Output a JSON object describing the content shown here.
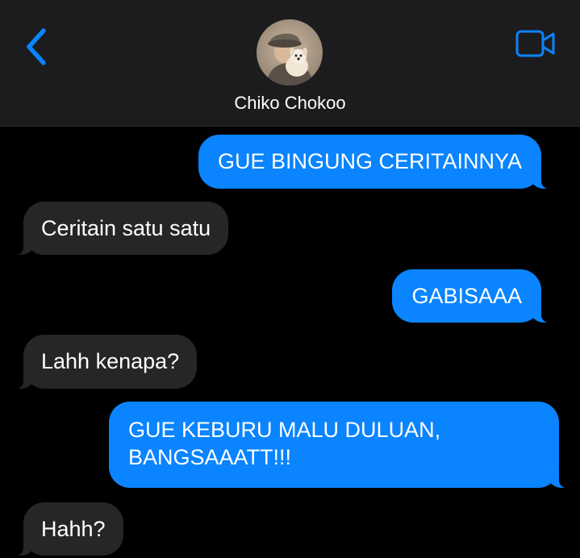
{
  "header": {
    "contact_name": "Chiko Chokoo",
    "back_icon": "chevron-left-icon",
    "video_icon": "video-camera-icon",
    "accent_color": "#0a84ff"
  },
  "messages": [
    {
      "direction": "sent",
      "text": "GUE BINGUNG CERITAINNYA"
    },
    {
      "direction": "received",
      "text": "Ceritain satu satu"
    },
    {
      "direction": "sent",
      "text": "GABISAAA"
    },
    {
      "direction": "received",
      "text": "Lahh kenapa?"
    },
    {
      "direction": "sent",
      "text": "GUE KEBURU MALU DULUAN, BANGSAAATT!!!"
    },
    {
      "direction": "received",
      "text": "Hahh?"
    }
  ],
  "colors": {
    "sent_bubble": "#0a84ff",
    "received_bubble": "#262629",
    "header_background": "#1c1c1e",
    "background": "#000000"
  }
}
